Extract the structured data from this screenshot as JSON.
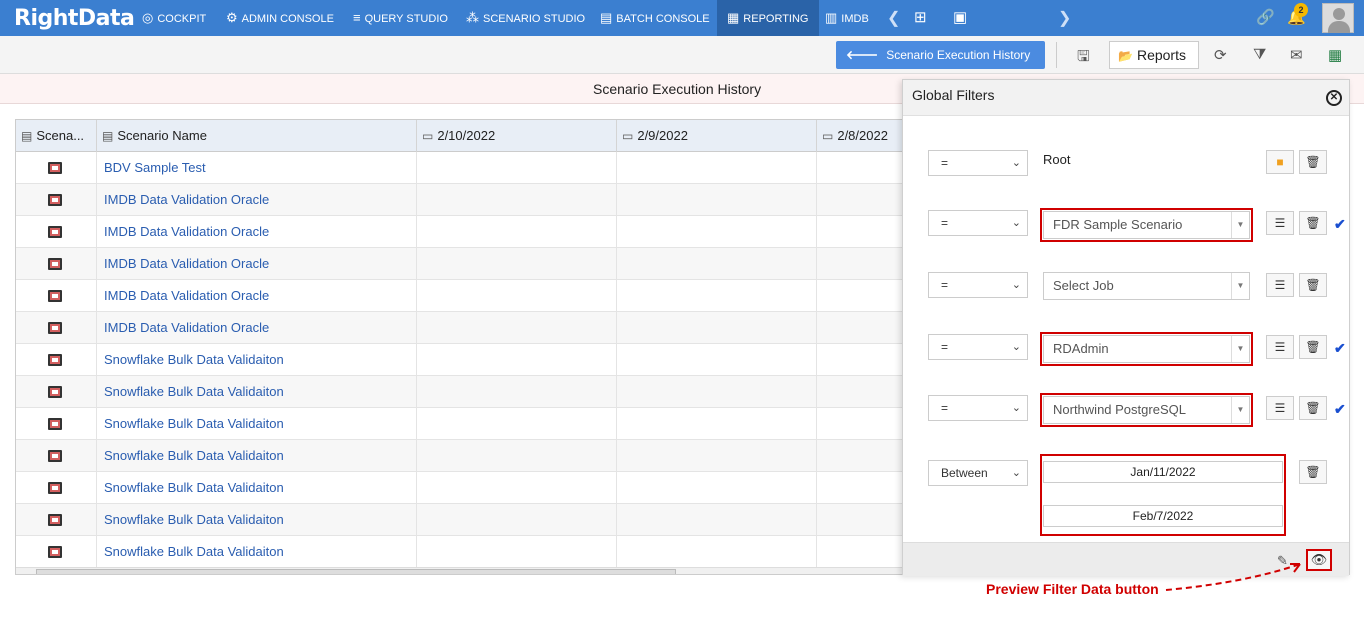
{
  "nav": {
    "logo": "RightData",
    "items": [
      {
        "label": "COCKPIT",
        "icon": "cockpit-icon"
      },
      {
        "label": "ADMIN CONSOLE",
        "icon": "gear-icon"
      },
      {
        "label": "QUERY STUDIO",
        "icon": "database-icon"
      },
      {
        "label": "SCENARIO STUDIO",
        "icon": "scenario-icon"
      },
      {
        "label": "BATCH CONSOLE",
        "icon": "batch-icon"
      },
      {
        "label": "REPORTING",
        "icon": "reporting-icon"
      },
      {
        "label": "IMDB",
        "icon": "imdb-icon"
      }
    ],
    "notification_count": "2"
  },
  "toolbar": {
    "back_label": "Scenario Execution History",
    "reports_label": "Reports"
  },
  "page": {
    "title": "Scenario Execution History"
  },
  "grid": {
    "headers": [
      "Scena...",
      "Scenario Name",
      "2/10/2022",
      "2/9/2022",
      "2/8/2022"
    ],
    "rows": [
      "BDV Sample Test",
      "IMDB Data Validation Oracle",
      "IMDB Data Validation Oracle",
      "IMDB Data Validation Oracle",
      "IMDB Data Validation Oracle",
      "IMDB Data Validation Oracle",
      "Snowflake Bulk Data Validaiton",
      "Snowflake Bulk Data Validaiton",
      "Snowflake Bulk Data Validaiton",
      "Snowflake Bulk Data Validaiton",
      "Snowflake Bulk Data Validaiton",
      "Snowflake Bulk Data Validaiton",
      "Snowflake Bulk Data Validaiton"
    ]
  },
  "filters": {
    "title": "Global Filters",
    "rows": [
      {
        "op": "=",
        "value": "Root"
      },
      {
        "op": "=",
        "value": "FDR Sample Scenario"
      },
      {
        "op": "=",
        "value": "Select Job"
      },
      {
        "op": "=",
        "value": "RDAdmin"
      },
      {
        "op": "=",
        "value": "Northwind PostgreSQL"
      },
      {
        "op": "Between",
        "from": "Jan/11/2022",
        "to": "Feb/7/2022"
      }
    ]
  },
  "annotation": {
    "label": "Preview Filter Data button",
    "color": "#d00000"
  }
}
